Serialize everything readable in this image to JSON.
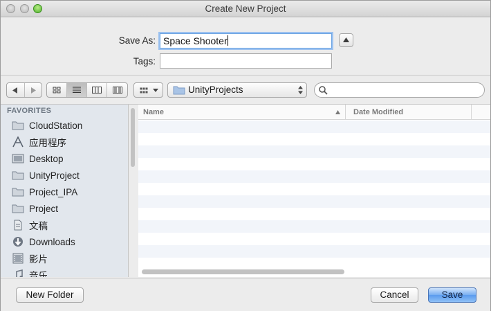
{
  "window": {
    "title": "Create New Project"
  },
  "form": {
    "save_as_label": "Save As:",
    "save_as_value": "Space Shooter",
    "tags_label": "Tags:",
    "tags_value": ""
  },
  "toolbar": {
    "location": "UnityProjects"
  },
  "sidebar": {
    "header": "FAVORITES",
    "items": [
      {
        "label": "CloudStation",
        "icon": "folder-icon"
      },
      {
        "label": "应用程序",
        "icon": "applications-icon"
      },
      {
        "label": "Desktop",
        "icon": "desktop-icon"
      },
      {
        "label": "UnityProject",
        "icon": "folder-icon"
      },
      {
        "label": "Project_IPA",
        "icon": "folder-icon"
      },
      {
        "label": "Project",
        "icon": "folder-icon"
      },
      {
        "label": "文稿",
        "icon": "documents-icon"
      },
      {
        "label": "Downloads",
        "icon": "downloads-icon"
      },
      {
        "label": "影片",
        "icon": "movies-icon"
      },
      {
        "label": "音乐",
        "icon": "music-icon"
      }
    ]
  },
  "filelist": {
    "col_name": "Name",
    "col_date": "Date Modified"
  },
  "buttons": {
    "new_folder": "New Folder",
    "cancel": "Cancel",
    "save": "Save"
  },
  "colors": {
    "accent": "#5a9bee",
    "sidebar_bg": "#e2e7ed"
  }
}
